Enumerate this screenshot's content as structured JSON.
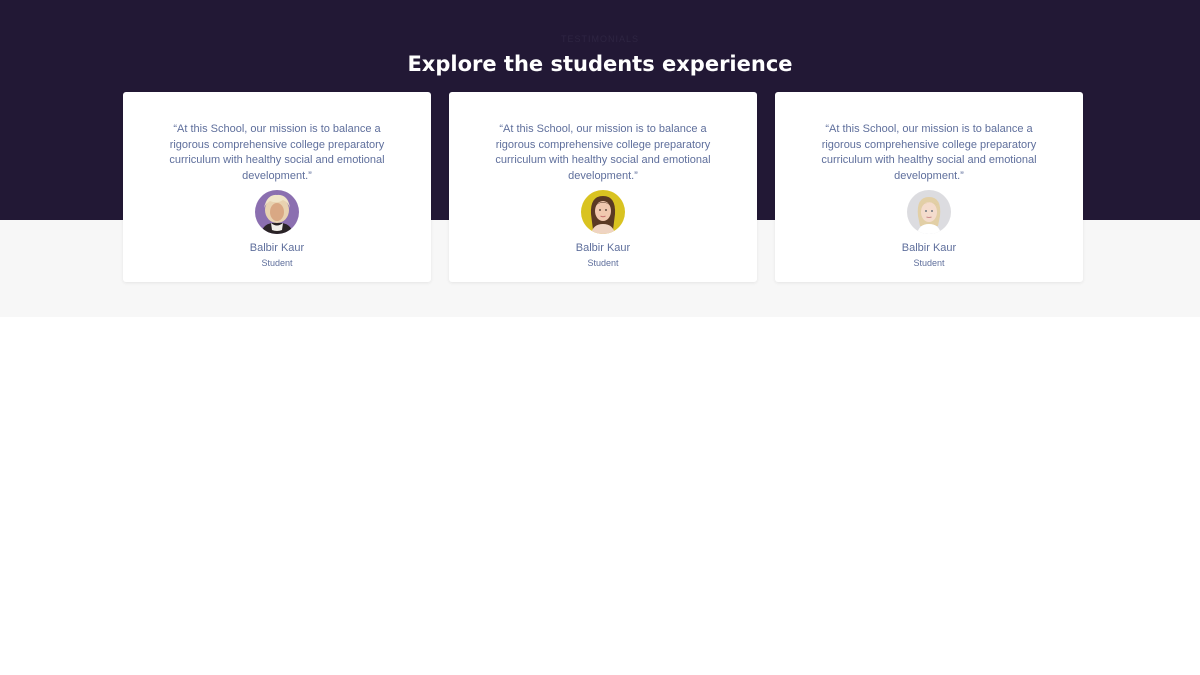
{
  "section": {
    "eyebrow": "TESTIMONIALS",
    "title": "Explore the students experience"
  },
  "colors": {
    "hero_background": "#221835",
    "lower_background": "#f7f7f7",
    "text_muted_blue": "#5f6f9c"
  },
  "testimonials": [
    {
      "quote": "“At this School, our mission is to balance a rigorous comprehensive college preparatory curriculum with healthy social and emotional development.”",
      "name": "Balbir Kaur",
      "role": "Student",
      "avatar_bg": "#8b6fb0"
    },
    {
      "quote": "“At this School, our mission is to balance a rigorous comprehensive college preparatory curriculum with healthy social and emotional development.”",
      "name": "Balbir Kaur",
      "role": "Student",
      "avatar_bg": "#d9c321"
    },
    {
      "quote": "“At this School, our mission is to balance a rigorous comprehensive college preparatory curriculum with healthy social and emotional development.”",
      "name": "Balbir Kaur",
      "role": "Student",
      "avatar_bg": "#dcdce0"
    }
  ]
}
